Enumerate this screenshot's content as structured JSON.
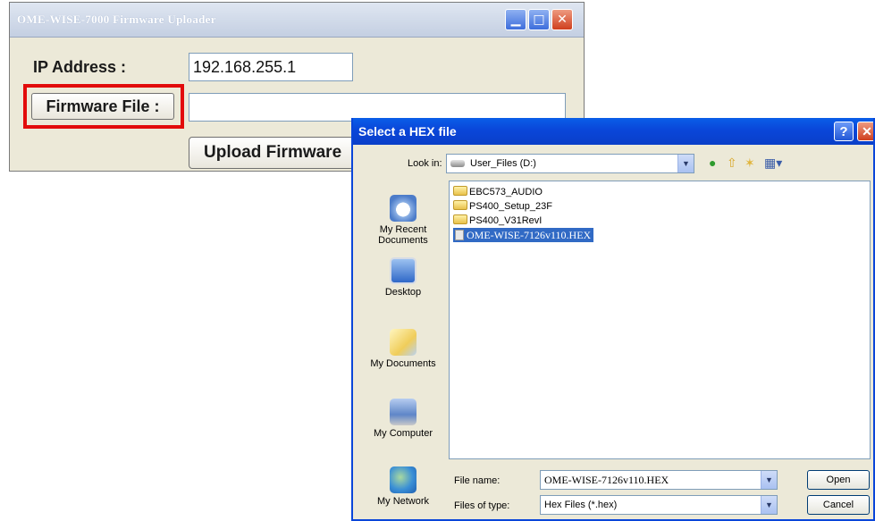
{
  "uploader": {
    "title": "OME-WISE-7000 Firmware Uploader",
    "ip_label": "IP Address :",
    "ip_value": "192.168.255.1",
    "firmware_button": "Firmware File :",
    "firmware_value": "",
    "upload_button": "Upload Firmware",
    "window_buttons": [
      "minimize",
      "maximize",
      "close"
    ],
    "highlight_color": "#e20b0b"
  },
  "dialog": {
    "title": "Select a HEX file",
    "help_label": "?",
    "close_label": "✕",
    "look_in_label": "Look in:",
    "look_in_value": "User_Files (D:)",
    "toolbar_icons": [
      "back-icon",
      "up-folder-icon",
      "new-folder-icon",
      "views-menu-icon"
    ],
    "places": [
      {
        "label": "My Recent Documents",
        "icon": "recent-documents-icon"
      },
      {
        "label": "Desktop",
        "icon": "desktop-icon"
      },
      {
        "label": "My Documents",
        "icon": "my-documents-icon"
      },
      {
        "label": "My Computer",
        "icon": "my-computer-icon"
      },
      {
        "label": "My Network",
        "icon": "my-network-icon"
      }
    ],
    "files": [
      {
        "name": "EBC573_AUDIO",
        "type": "folder"
      },
      {
        "name": "PS400_Setup_23F",
        "type": "folder"
      },
      {
        "name": "PS400_V31RevI",
        "type": "folder"
      },
      {
        "name": "OME-WISE-7126v110.HEX",
        "type": "file",
        "selected": true
      }
    ],
    "file_name_label": "File name:",
    "file_name_value": "OME-WISE-7126v110.HEX",
    "file_type_label": "Files of type:",
    "file_type_value": "Hex Files (*.hex)",
    "open_button": "Open",
    "cancel_button": "Cancel",
    "accent_color": "#0a46d9",
    "selection_color": "#316ac5"
  }
}
